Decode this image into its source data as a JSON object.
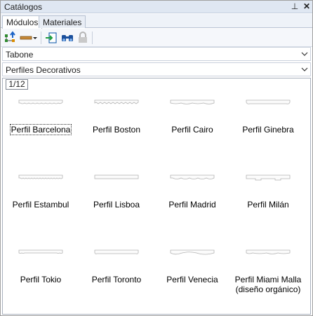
{
  "window": {
    "title": "Catálogos",
    "pin_glyph": "⊥",
    "close_glyph": "✕"
  },
  "tabs": [
    {
      "label": "Módulos",
      "active": true
    },
    {
      "label": "Materiales",
      "active": false
    }
  ],
  "toolbar": {
    "icons": [
      "tree-arrow-icon",
      "ruler-dropdown-icon",
      "insert-icon",
      "binoculars-icon",
      "lock-icon"
    ]
  },
  "combos": {
    "catalog": "Tabone",
    "category": "Perfiles Decorativos"
  },
  "pager": {
    "label": "1/12"
  },
  "items": [
    {
      "label": "Perfil Barcelona",
      "selected": true
    },
    {
      "label": "Perfil Boston",
      "selected": false
    },
    {
      "label": "Perfil Cairo",
      "selected": false
    },
    {
      "label": "Perfil Ginebra",
      "selected": false
    },
    {
      "label": "Perfil Estambul",
      "selected": false
    },
    {
      "label": "Perfil Lisboa",
      "selected": false
    },
    {
      "label": "Perfil Madrid",
      "selected": false
    },
    {
      "label": "Perfil Milán",
      "selected": false
    },
    {
      "label": "Perfil Tokio",
      "selected": false
    },
    {
      "label": "Perfil Toronto",
      "selected": false
    },
    {
      "label": "Perfil Venecia",
      "selected": false
    },
    {
      "label": "Perfil Miami Malla (diseño orgánico)",
      "selected": false
    }
  ]
}
